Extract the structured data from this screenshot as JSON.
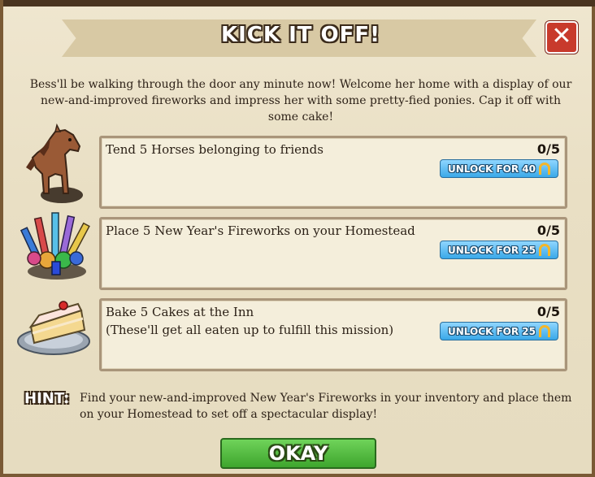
{
  "dialog": {
    "title": "KICK IT OFF!",
    "close_label": "✕",
    "intro": "Bess'll be walking through the door any minute now! Welcome her home with a display of our new-and-improved fireworks and impress her with some pretty-fied ponies. Cap it off with some cake!"
  },
  "tasks": [
    {
      "icon": "horse-icon",
      "line1": "Tend 5 Horses belonging to friends",
      "line2": "",
      "count": "0/5",
      "unlock_label": "UNLOCK FOR 40"
    },
    {
      "icon": "fireworks-icon",
      "line1": "Place 5 New Year's Fireworks on your Homestead",
      "line2": "",
      "count": "0/5",
      "unlock_label": "UNLOCK FOR 25"
    },
    {
      "icon": "cake-icon",
      "line1": "Bake 5 Cakes at the Inn",
      "line2": "(These'll get all eaten up to fulfill this mission)",
      "count": "0/5",
      "unlock_label": "UNLOCK FOR 25"
    }
  ],
  "hint": {
    "label": "HINT:",
    "text": "Find your new-and-improved New Year's Fireworks in your inventory and place them on your Homestead to set off a spectacular display!"
  },
  "footer": {
    "okay_label": "OKAY"
  },
  "colors": {
    "parchment": "#e9dfc4",
    "close_red": "#c83a2c",
    "unlock_blue": "#3aa8e8",
    "okay_green": "#4cb83a",
    "horseshoe_gold": "#f3b62a"
  }
}
